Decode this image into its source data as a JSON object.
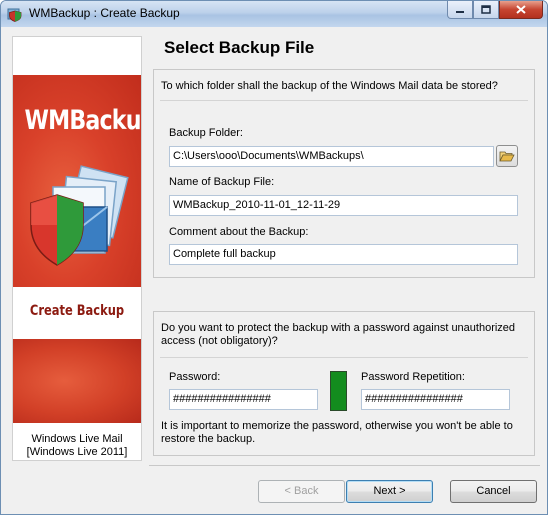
{
  "window": {
    "title": "WMBackup : Create Backup"
  },
  "banner": {
    "brand": "WMBackup",
    "subtitle": "Create Backup",
    "footer_line1": "Windows Live Mail",
    "footer_line2": "[Windows Live 2011]"
  },
  "page": {
    "heading": "Select Backup File"
  },
  "folder_group": {
    "question": "To which folder shall the backup of the Windows Mail data be stored?",
    "folder_label": "Backup Folder:",
    "folder_value": "C:\\Users\\ooo\\Documents\\WMBackups\\",
    "name_label": "Name of Backup File:",
    "name_value": "WMBackup_2010-11-01_12-11-29",
    "comment_label": "Comment about the Backup:",
    "comment_value": "Complete full backup"
  },
  "password_group": {
    "question_line1": "Do you want to protect the backup with a password against unauthorized",
    "question_line2": "access (not obligatory)?",
    "password_label": "Password:",
    "password_value": "################",
    "repeat_label": "Password Repetition:",
    "repeat_value": "################",
    "note_line1": "It is important to memorize the password, otherwise you won't be able to",
    "note_line2": "restore the backup.",
    "match_indicator_color": "#138c1e"
  },
  "buttons": {
    "back": "< Back",
    "next": "Next >",
    "cancel": "Cancel"
  },
  "icons": {
    "app": "wmbackup-app-icon",
    "minimize": "minimize-icon",
    "maximize": "maximize-icon",
    "close": "close-icon",
    "browse": "folder-open-icon"
  }
}
